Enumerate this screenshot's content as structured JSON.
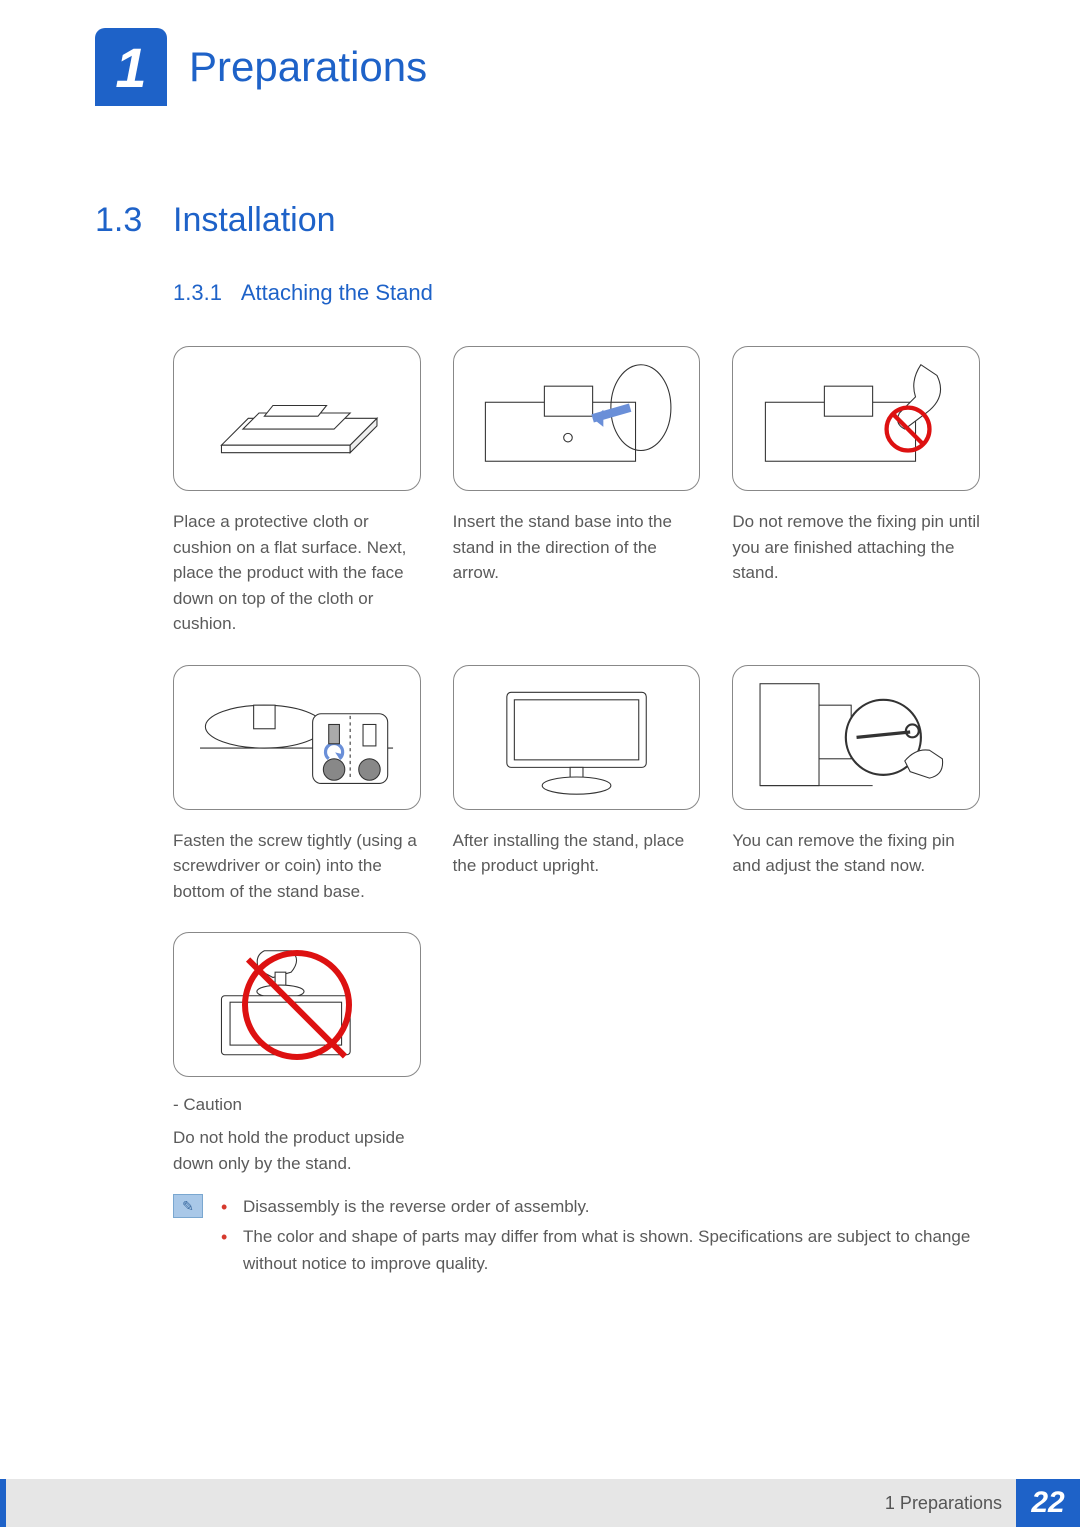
{
  "header": {
    "chapter_number": "1",
    "chapter_title": "Preparations"
  },
  "section": {
    "number": "1.3",
    "title": "Installation"
  },
  "subsection": {
    "number": "1.3.1",
    "title": "Attaching the Stand"
  },
  "steps": [
    {
      "caption": "Place a protective cloth or cushion on a flat surface. Next, place the product with the face down on top of the cloth or cushion."
    },
    {
      "caption": "Insert the stand base into the stand in the direction of the arrow."
    },
    {
      "caption": "Do not remove the fixing pin until you are finished attaching the stand."
    },
    {
      "caption": "Fasten the screw tightly (using a screwdriver or coin) into the bottom of the stand base."
    },
    {
      "caption": "After installing the stand, place the product upright."
    },
    {
      "caption": "You can remove the fixing pin and adjust the stand now."
    },
    {
      "caution_label": "- Caution",
      "caption": "Do not hold the product upside down only by the stand."
    }
  ],
  "notes": [
    "Disassembly is the reverse order of assembly.",
    "The color and shape of parts may differ from what is shown. Specifications are subject to change without notice to improve quality."
  ],
  "footer": {
    "label": "1 Preparations",
    "page": "22"
  }
}
